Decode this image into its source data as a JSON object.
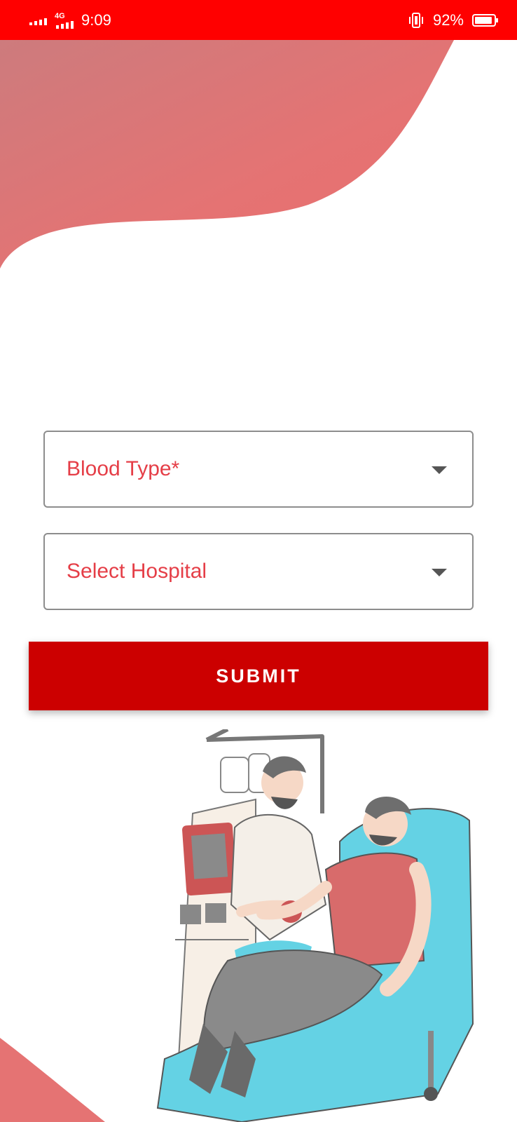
{
  "status_bar": {
    "network": "4G",
    "time": "9:09",
    "battery_percent": "92%",
    "battery_level": 0.92,
    "background_color": "#ff0000"
  },
  "form": {
    "blood_type": {
      "label": "Blood Type*"
    },
    "hospital": {
      "label": "Select Hospital"
    },
    "submit_label": "SUBMIT"
  },
  "colors": {
    "accent": "#cc0000",
    "label_text": "#e53e47",
    "wave": "#e57373",
    "field_border": "#8d8d8d"
  },
  "icons": {
    "signal": "signal-bars-icon",
    "vibrate": "vibrate-icon",
    "battery": "battery-icon",
    "dropdown": "chevron-down-icon"
  },
  "illustration": {
    "subject": "blood-donation-illustration"
  }
}
